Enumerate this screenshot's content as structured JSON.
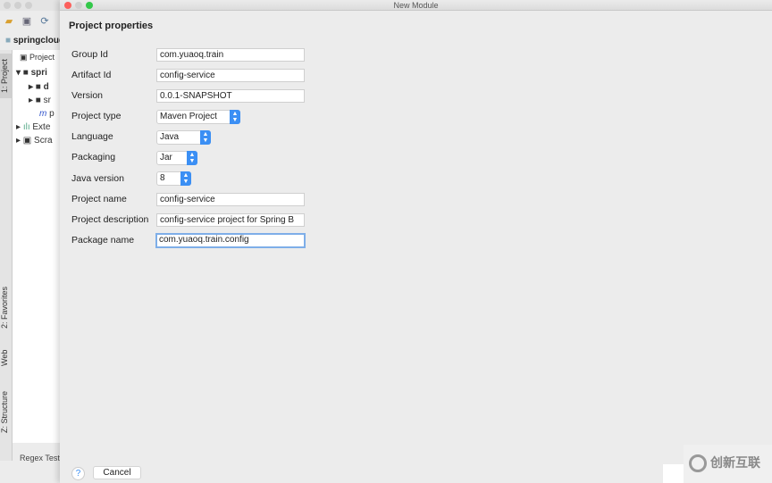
{
  "ide": {
    "breadcrumb": "springcloud",
    "project_view": "Project",
    "tree": [
      {
        "label": "spri",
        "icon": "module-folder-icon"
      },
      {
        "label": "d",
        "icon": "folder-icon"
      },
      {
        "label": "sr",
        "icon": "folder-icon"
      },
      {
        "label": "p",
        "icon": "maven-icon"
      },
      {
        "label": "Exte",
        "icon": "libraries-icon"
      },
      {
        "label": "Scra",
        "icon": "scratches-icon"
      }
    ],
    "tool_tabs": [
      "1: Project",
      "2: Favorites",
      "Web",
      "Z: Structure"
    ],
    "bottom_tab": "Regex Test"
  },
  "dialog": {
    "window_title": "New Module",
    "section_title": "Project properties",
    "fields": [
      {
        "label": "Group Id",
        "value": "com.yuaoq.train",
        "type": "text"
      },
      {
        "label": "Artifact Id",
        "value": "config-service",
        "type": "text"
      },
      {
        "label": "Version",
        "value": "0.0.1-SNAPSHOT",
        "type": "text"
      },
      {
        "label": "Project type",
        "value": "Maven Project",
        "type": "select"
      },
      {
        "label": "Language",
        "value": "Java",
        "type": "select"
      },
      {
        "label": "Packaging",
        "value": "Jar",
        "type": "select"
      },
      {
        "label": "Java version",
        "value": "8",
        "type": "select"
      },
      {
        "label": "Project name",
        "value": "config-service",
        "type": "text"
      },
      {
        "label": "Project description",
        "value": "config-service project for Spring B",
        "type": "text"
      },
      {
        "label": "Package name",
        "value": "com.yuaoq.train.config",
        "type": "text",
        "focused": true
      }
    ],
    "help_label": "?",
    "cancel_label": "Cancel"
  },
  "watermark": {
    "text": "创新互联"
  },
  "colors": {
    "accent": "#3b8ff4",
    "focus": "#7eaee8"
  }
}
